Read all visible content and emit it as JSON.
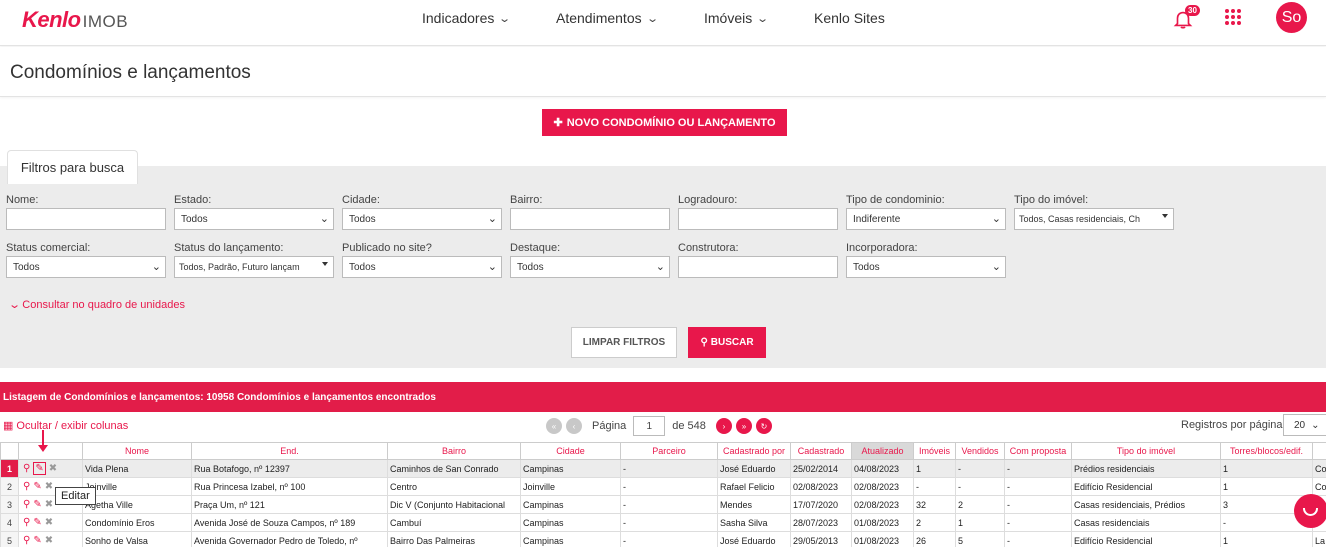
{
  "nav": {
    "logo_brand": "Kenlo",
    "logo_product": "IMOB",
    "items": [
      {
        "label": "Indicadores"
      },
      {
        "label": "Atendimentos"
      },
      {
        "label": "Imóveis"
      },
      {
        "label": "Kenlo Sites"
      }
    ],
    "notifications": "30",
    "avatar": "So"
  },
  "page": {
    "title": "Condomínios e lançamentos",
    "new_button": "NOVO CONDOMÍNIO OU LANÇAMENTO"
  },
  "filters": {
    "tab": "Filtros para busca",
    "fields": {
      "nome": {
        "label": "Nome:",
        "value": ""
      },
      "estado": {
        "label": "Estado:",
        "value": "Todos"
      },
      "cidade": {
        "label": "Cidade:",
        "value": "Todos"
      },
      "bairro": {
        "label": "Bairro:",
        "value": ""
      },
      "logradouro": {
        "label": "Logradouro:",
        "value": ""
      },
      "tipo_condominio": {
        "label": "Tipo de condominio:",
        "value": "Indiferente"
      },
      "tipo_imovel": {
        "label": "Tipo do imóvel:",
        "value": "Todos, Casas residenciais, Ch"
      },
      "status_comercial": {
        "label": "Status comercial:",
        "value": "Todos"
      },
      "status_lancamento": {
        "label": "Status do lançamento:",
        "value": "Todos, Padrão, Futuro lançam"
      },
      "publicado": {
        "label": "Publicado no site?",
        "value": "Todos"
      },
      "destaque": {
        "label": "Destaque:",
        "value": "Todos"
      },
      "construtora": {
        "label": "Construtora:",
        "value": ""
      },
      "incorporadora": {
        "label": "Incorporadora:",
        "value": "Todos"
      }
    },
    "consult_link": "Consultar no quadro de unidades",
    "clear_button": "LIMPAR FILTROS",
    "search_button": "BUSCAR"
  },
  "listing": {
    "header": "Listagem de Condomínios e lançamentos: 10958 Condomínios e lançamentos encontrados",
    "toggle_columns": "Ocultar / exibir colunas",
    "page_label": "Página",
    "page_value": "1",
    "page_total": "de 548",
    "per_page_label": "Registros por página",
    "per_page_value": "20",
    "columns": [
      "Nome",
      "End.",
      "Bairro",
      "Cidade",
      "Parceiro",
      "Cadastrado por",
      "Cadastrado",
      "Atualizado",
      "Imóveis",
      "Vendidos",
      "Com proposta",
      "Tipo do imóvel",
      "Torres/blocos/edif."
    ],
    "rows": [
      {
        "n": "1",
        "nome": "Vida Plena",
        "end": "Rua Botafogo, nº 12397",
        "bairro": "Caminhos de San Conrado",
        "cidade": "Campinas",
        "parceiro": "-",
        "por": "José Eduardo",
        "cad": "25/02/2014",
        "atu": "04/08/2023",
        "imoveis": "1",
        "vend": "-",
        "prop": "-",
        "tipo": "Prédios residenciais",
        "torres": "1",
        "extra": "Co"
      },
      {
        "n": "2",
        "nome": "Joinville",
        "end": "Rua Princesa Izabel, nº 100",
        "bairro": "Centro",
        "cidade": "Joinville",
        "parceiro": "-",
        "por": "Rafael Felicio",
        "cad": "02/08/2023",
        "atu": "02/08/2023",
        "imoveis": "-",
        "vend": "-",
        "prop": "-",
        "tipo": "Edifício Residencial",
        "torres": "1",
        "extra": "Co"
      },
      {
        "n": "3",
        "nome": "Agetha Ville",
        "end": "Praça Um, nº 121",
        "bairro": "Dic V (Conjunto Habitacional",
        "cidade": "Campinas",
        "parceiro": "-",
        "por": "Mendes",
        "cad": "17/07/2020",
        "atu": "02/08/2023",
        "imoveis": "32",
        "vend": "2",
        "prop": "-",
        "tipo": "Casas residenciais, Prédios",
        "torres": "3",
        "extra": ""
      },
      {
        "n": "4",
        "nome": "Condomínio Eros",
        "end": "Avenida José de Souza Campos, nº 189",
        "bairro": "Cambuí",
        "cidade": "Campinas",
        "parceiro": "-",
        "por": "Sasha Silva",
        "cad": "28/07/2023",
        "atu": "01/08/2023",
        "imoveis": "2",
        "vend": "1",
        "prop": "-",
        "tipo": "Casas residenciais",
        "torres": "-",
        "extra": ""
      },
      {
        "n": "5",
        "nome": "Sonho de Valsa",
        "end": "Avenida Governador Pedro de Toledo, nº",
        "bairro": "Bairro Das Palmeiras",
        "cidade": "Campinas",
        "parceiro": "-",
        "por": "José Eduardo",
        "cad": "29/05/2013",
        "atu": "01/08/2023",
        "imoveis": "26",
        "vend": "5",
        "prop": "-",
        "tipo": "Edifício Residencial",
        "torres": "1",
        "extra": "La"
      }
    ],
    "tooltip": "Editar"
  },
  "colors": {
    "accent": "#e8174b",
    "listbar": "#e21d49",
    "filters_bg": "#ececec"
  }
}
